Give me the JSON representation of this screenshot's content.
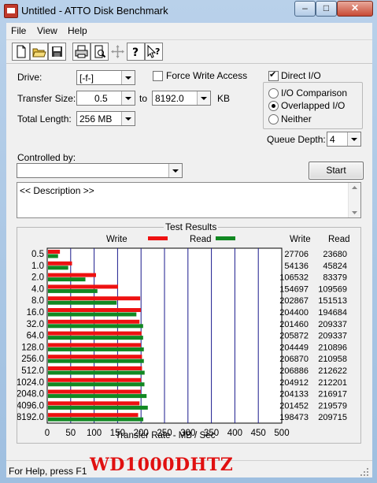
{
  "window": {
    "title": "Untitled - ATTO Disk Benchmark",
    "buttons": {
      "minimize": "–",
      "maximize": "□",
      "close": "✕"
    }
  },
  "menu": [
    "File",
    "View",
    "Help"
  ],
  "toolbar": {
    "icons": [
      "new-document-icon",
      "open-folder-icon",
      "save-icon",
      "print-icon",
      "print-preview-icon",
      "move-icon",
      "help-icon",
      "context-help-icon"
    ]
  },
  "form": {
    "drive_label": "Drive:",
    "drive_value": "[-f-]",
    "force_write_label": "Force Write Access",
    "force_write_checked": false,
    "direct_io_label": "Direct I/O",
    "direct_io_checked": true,
    "transfer_size_label": "Transfer Size:",
    "transfer_from": "0.5",
    "to_label": "to",
    "transfer_to": "8192.0",
    "kb_label": "KB",
    "total_length_label": "Total Length:",
    "total_length_value": "256 MB",
    "radio_io_comparison": "I/O Comparison",
    "radio_overlapped": "Overlapped I/O",
    "radio_neither": "Neither",
    "selected_mode": "Overlapped I/O",
    "queue_depth_label": "Queue Depth:",
    "queue_depth_value": "4",
    "controlled_by_label": "Controlled by:",
    "controlled_by_value": "",
    "start_label": "Start",
    "description": "<< Description >>"
  },
  "results": {
    "title": "Test Results",
    "legend_write": "Write",
    "legend_read": "Read",
    "col_write": "Write",
    "col_read": "Read",
    "colors": {
      "write": "#ee1111",
      "read": "#118822",
      "grid": "#1a1a8c"
    }
  },
  "chart_data": {
    "type": "bar",
    "orientation": "horizontal",
    "categories": [
      "0.5",
      "1.0",
      "2.0",
      "4.0",
      "8.0",
      "16.0",
      "32.0",
      "64.0",
      "128.0",
      "256.0",
      "512.0",
      "1024.0",
      "2048.0",
      "4096.0",
      "8192.0"
    ],
    "series": [
      {
        "name": "Write",
        "values": [
          27706,
          54136,
          106532,
          154697,
          202867,
          204400,
          201460,
          205872,
          204449,
          206870,
          206886,
          204912,
          204133,
          201452,
          198473
        ]
      },
      {
        "name": "Read",
        "values": [
          23680,
          45824,
          83379,
          109569,
          151513,
          194684,
          209337,
          209337,
          210896,
          210958,
          212622,
          212201,
          216917,
          219579,
          209715
        ]
      }
    ],
    "xlabel": "Transfer Rate - MB / Sec",
    "xticks": [
      "0",
      "50",
      "100",
      "150",
      "200",
      "250",
      "300",
      "350",
      "400",
      "450",
      "500"
    ],
    "xlim": [
      0,
      500
    ],
    "legend": "top",
    "grid": true
  },
  "status": "For Help, press F1",
  "overlay": "WD1000DHTZ"
}
